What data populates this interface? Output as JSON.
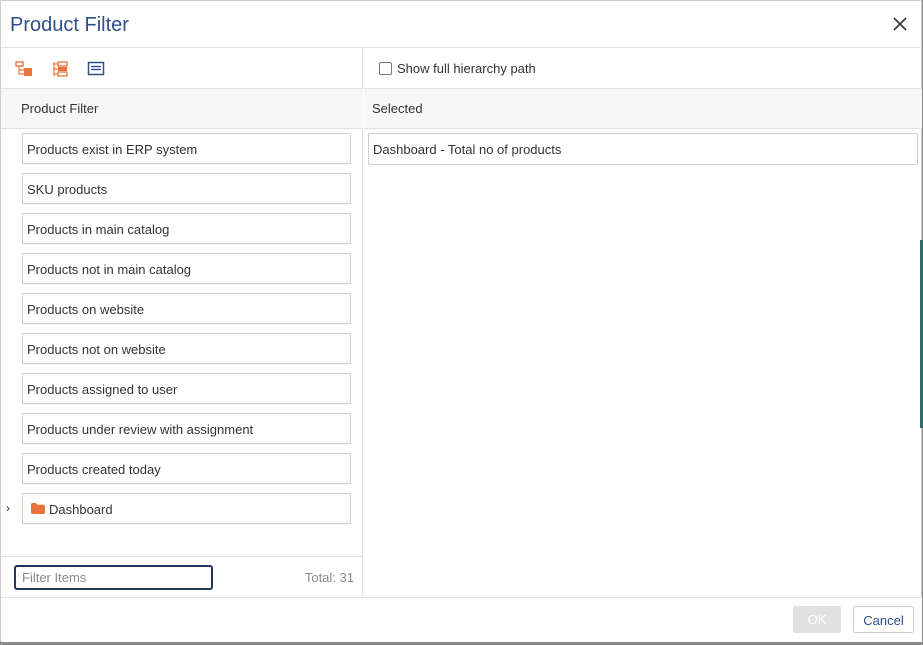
{
  "dialog": {
    "title": "Product Filter"
  },
  "toolbar": {
    "icons": [
      "tree-expand-icon",
      "tree-collapse-icon",
      "list-view-icon"
    ],
    "accent_color": "#e8743b",
    "list_icon_color": "#2f4f8a"
  },
  "left_panel": {
    "header": "Product Filter",
    "items": [
      {
        "label": "Products exist in ERP system"
      },
      {
        "label": "SKU products"
      },
      {
        "label": "Products in main catalog"
      },
      {
        "label": "Products not in main catalog"
      },
      {
        "label": "Products on website"
      },
      {
        "label": "Products not on website"
      },
      {
        "label": "Products assigned to user"
      },
      {
        "label": "Products under review with assignment"
      },
      {
        "label": "Products created today"
      },
      {
        "label": "Dashboard",
        "type": "folder",
        "expander": "›"
      }
    ],
    "filter": {
      "placeholder": "Filter Items",
      "value": ""
    },
    "total": "Total: 31"
  },
  "right_panel": {
    "show_full_path_label": "Show full hierarchy path",
    "show_full_path_checked": false,
    "header": "Selected",
    "selected_items": [
      {
        "label": "Dashboard - Total no of products"
      }
    ]
  },
  "footer": {
    "ok_label": "OK",
    "cancel_label": "Cancel"
  }
}
